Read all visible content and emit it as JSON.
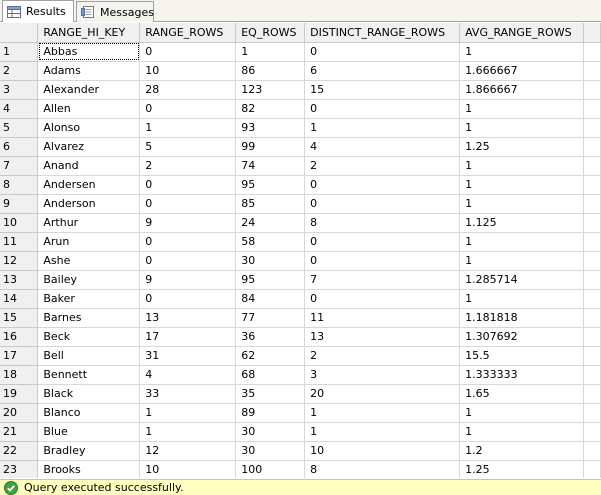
{
  "tabs": [
    {
      "label": "Results",
      "active": true,
      "icon": "grid-icon"
    },
    {
      "label": "Messages",
      "active": false,
      "icon": "messages-icon"
    }
  ],
  "grid": {
    "columns": [
      "RANGE_HI_KEY",
      "RANGE_ROWS",
      "EQ_ROWS",
      "DISTINCT_RANGE_ROWS",
      "AVG_RANGE_ROWS"
    ],
    "rows": [
      [
        "1",
        "Abbas",
        "0",
        "1",
        "0",
        "1"
      ],
      [
        "2",
        "Adams",
        "10",
        "86",
        "6",
        "1.666667"
      ],
      [
        "3",
        "Alexander",
        "28",
        "123",
        "15",
        "1.866667"
      ],
      [
        "4",
        "Allen",
        "0",
        "82",
        "0",
        "1"
      ],
      [
        "5",
        "Alonso",
        "1",
        "93",
        "1",
        "1"
      ],
      [
        "6",
        "Alvarez",
        "5",
        "99",
        "4",
        "1.25"
      ],
      [
        "7",
        "Anand",
        "2",
        "74",
        "2",
        "1"
      ],
      [
        "8",
        "Andersen",
        "0",
        "95",
        "0",
        "1"
      ],
      [
        "9",
        "Anderson",
        "0",
        "85",
        "0",
        "1"
      ],
      [
        "10",
        "Arthur",
        "9",
        "24",
        "8",
        "1.125"
      ],
      [
        "11",
        "Arun",
        "0",
        "58",
        "0",
        "1"
      ],
      [
        "12",
        "Ashe",
        "0",
        "30",
        "0",
        "1"
      ],
      [
        "13",
        "Bailey",
        "9",
        "95",
        "7",
        "1.285714"
      ],
      [
        "14",
        "Baker",
        "0",
        "84",
        "0",
        "1"
      ],
      [
        "15",
        "Barnes",
        "13",
        "77",
        "11",
        "1.181818"
      ],
      [
        "16",
        "Beck",
        "17",
        "36",
        "13",
        "1.307692"
      ],
      [
        "17",
        "Bell",
        "31",
        "62",
        "2",
        "15.5"
      ],
      [
        "18",
        "Bennett",
        "4",
        "68",
        "3",
        "1.333333"
      ],
      [
        "19",
        "Black",
        "33",
        "35",
        "20",
        "1.65"
      ],
      [
        "20",
        "Blanco",
        "1",
        "89",
        "1",
        "1"
      ],
      [
        "21",
        "Blue",
        "1",
        "30",
        "1",
        "1"
      ],
      [
        "22",
        "Bradley",
        "12",
        "30",
        "10",
        "1.2"
      ],
      [
        "23",
        "Brooks",
        "10",
        "100",
        "8",
        "1.25"
      ]
    ]
  },
  "status": {
    "message": "Query executed successfully.",
    "color": "#ffffc0",
    "icon": "success-check-icon"
  }
}
